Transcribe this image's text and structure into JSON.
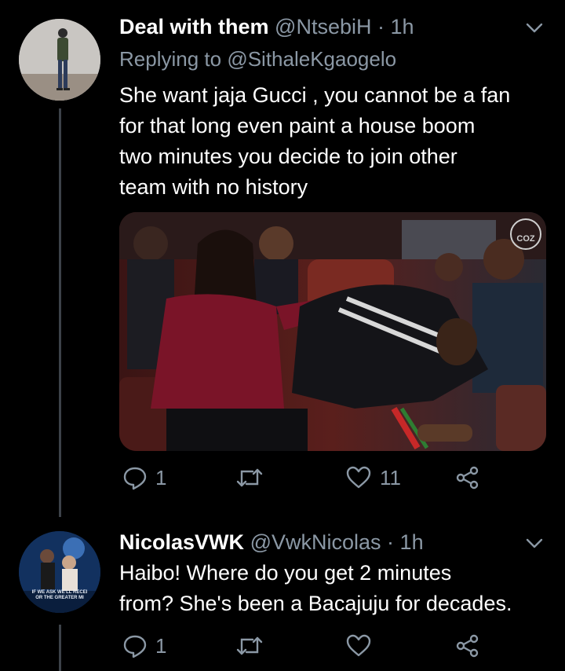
{
  "tweets": [
    {
      "name": "Deal with them",
      "handle": "@NtsebiH",
      "dot": "·",
      "time": "1h",
      "replying_prefix": "Replying to",
      "replying_handle": "@SithaleKgaogelo",
      "text_lines": [
        "She want jaja Gucci , you cannot be a fan",
        "for that long even paint a house boom",
        "two minutes you decide to join other",
        "team with no history"
      ],
      "media_watermark": "COZ",
      "reply_count": "1",
      "retweet_count": "",
      "like_count": "11"
    },
    {
      "name": "NicolasVWK",
      "handle": "@VwkNicolas",
      "dot": "·",
      "time": "1h",
      "text_lines": [
        "Haibo! Where do you get 2 minutes",
        "from? She's been a Bacajuju for decades."
      ],
      "avatar_caption_lines": [
        "IF WE ASK WE'LL RECEI",
        "OR THE GREATER MI"
      ],
      "reply_count": "1",
      "retweet_count": "",
      "like_count": ""
    }
  ],
  "icons": {
    "reply": "reply-icon",
    "retweet": "retweet-icon",
    "like": "heart-icon",
    "share": "share-icon",
    "menu": "chevron-down-icon"
  },
  "colors": {
    "background": "#000000",
    "secondary_text": "#8b98a5",
    "thread_line": "#3d4249"
  }
}
